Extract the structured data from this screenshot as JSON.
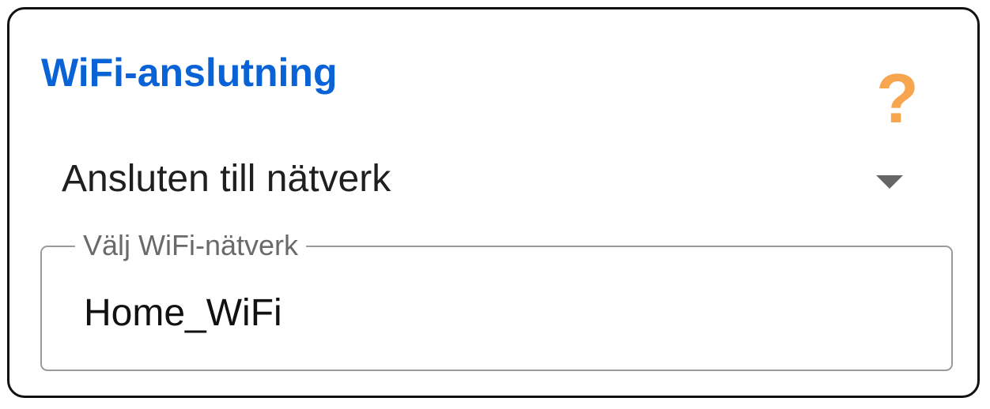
{
  "card": {
    "title": "WiFi-anslutning",
    "help_glyph": "?"
  },
  "connection_mode": {
    "selected": "Ansluten till nätverk"
  },
  "wifi_network": {
    "label": "Välj WiFi-nätverk",
    "value": "Home_WiFi"
  },
  "icons": {
    "help": "question-mark-icon",
    "dropdown": "caret-down-icon"
  },
  "colors": {
    "title": "#0a63d6",
    "help_icon": "#f7a54f",
    "caret": "#666666",
    "field_border": "#9a9a9a"
  }
}
